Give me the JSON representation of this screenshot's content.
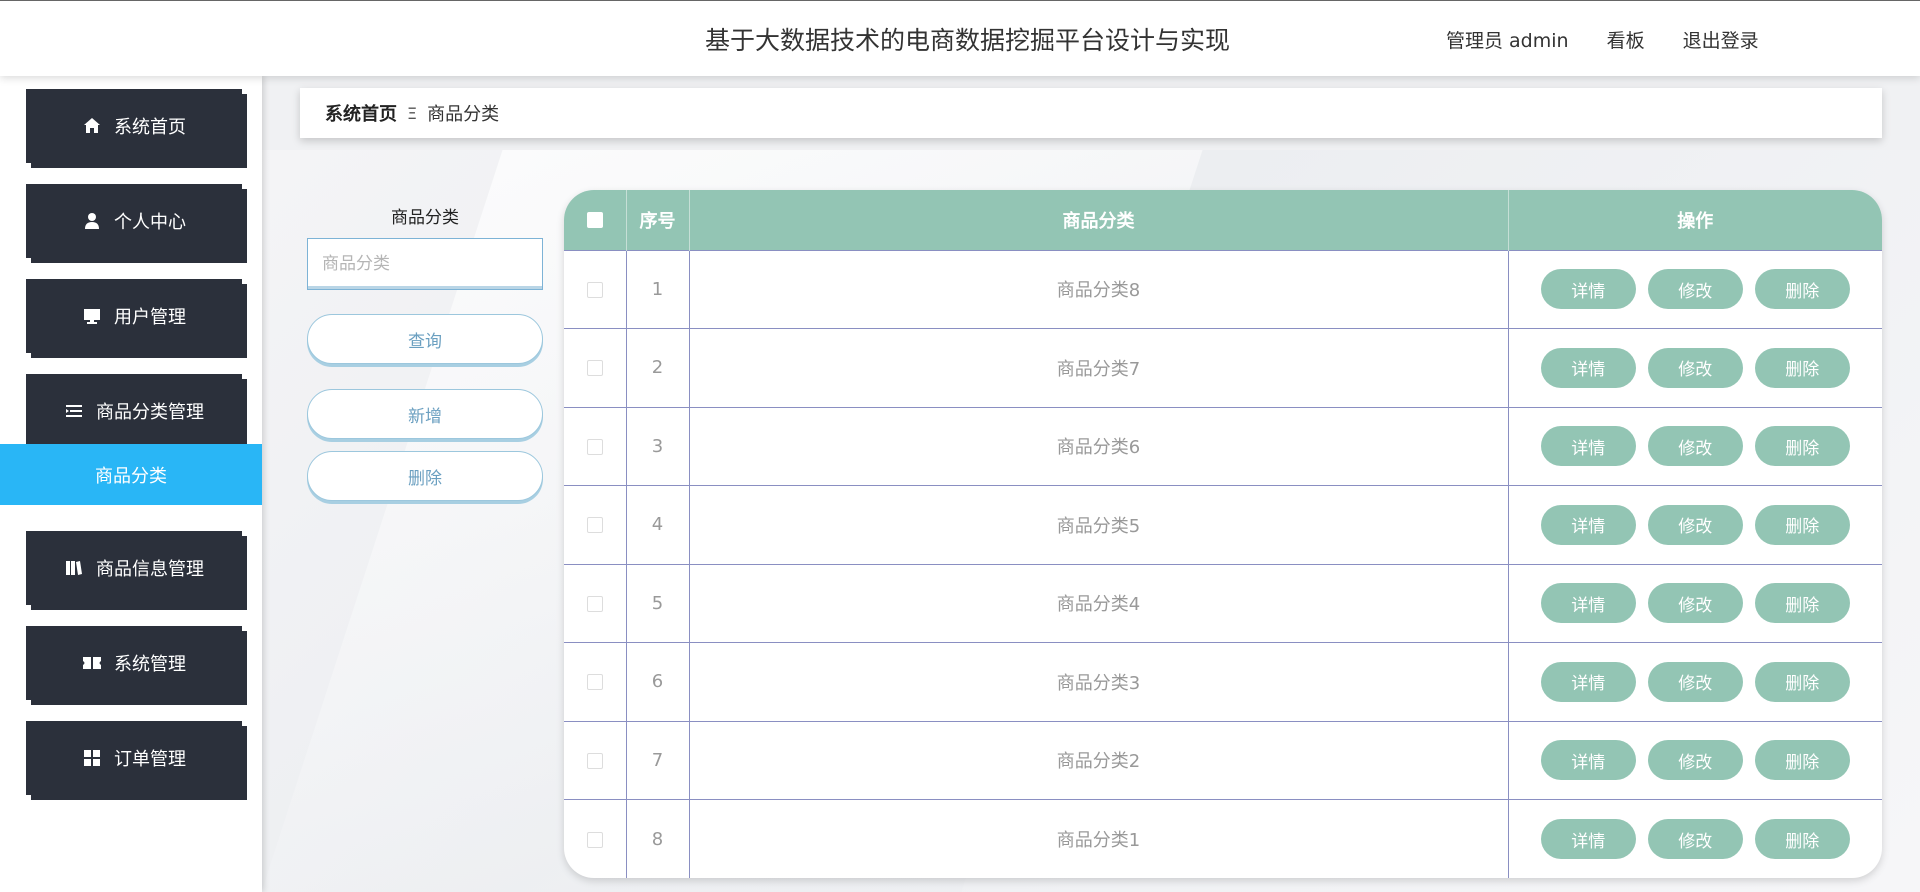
{
  "header": {
    "title": "基于大数据技术的电商数据挖掘平台设计与实现",
    "user": "管理员 admin",
    "board": "看板",
    "logout": "退出登录"
  },
  "sidebar": {
    "items": [
      {
        "label": "系统首页",
        "icon": "home-icon"
      },
      {
        "label": "个人中心",
        "icon": "user-icon"
      },
      {
        "label": "用户管理",
        "icon": "monitor-icon"
      },
      {
        "label": "商品分类管理",
        "icon": "list-icon"
      },
      {
        "label": "商品信息管理",
        "icon": "book-icon"
      },
      {
        "label": "系统管理",
        "icon": "ticket-icon"
      },
      {
        "label": "订单管理",
        "icon": "grid-icon"
      }
    ],
    "active_sub": "商品分类"
  },
  "breadcrumb": {
    "home": "系统首页",
    "separator": "Ξ",
    "current": "商品分类"
  },
  "search": {
    "label": "商品分类",
    "placeholder": "商品分类",
    "query_button": "查询",
    "add_button": "新增",
    "delete_button": "删除"
  },
  "table": {
    "headers": {
      "index": "序号",
      "category": "商品分类",
      "actions": "操作"
    },
    "action_labels": {
      "detail": "详情",
      "edit": "修改",
      "delete": "删除"
    },
    "rows": [
      {
        "index": "1",
        "category": "商品分类8"
      },
      {
        "index": "2",
        "category": "商品分类7"
      },
      {
        "index": "3",
        "category": "商品分类6"
      },
      {
        "index": "4",
        "category": "商品分类5"
      },
      {
        "index": "5",
        "category": "商品分类4"
      },
      {
        "index": "6",
        "category": "商品分类3"
      },
      {
        "index": "7",
        "category": "商品分类2"
      },
      {
        "index": "8",
        "category": "商品分类1"
      }
    ]
  },
  "colors": {
    "sidebar_item_bg": "#2b303b",
    "active_sub_bg": "#29b6f6",
    "table_accent": "#93c5b4"
  }
}
